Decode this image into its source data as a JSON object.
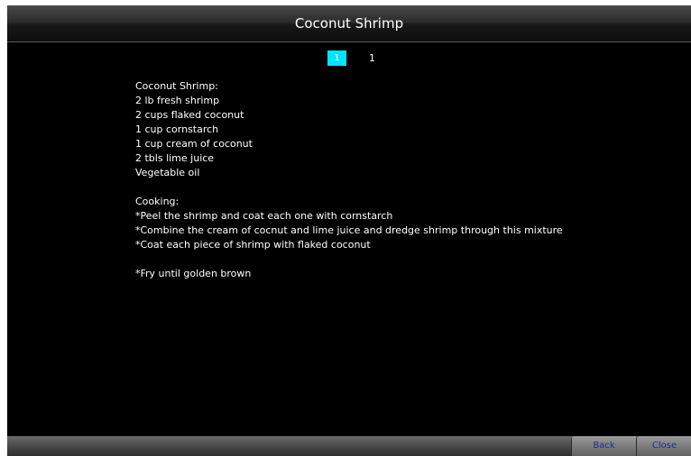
{
  "window": {
    "title": "Coconut Shrimp"
  },
  "pager": {
    "current_page": "1",
    "total_pages": "1"
  },
  "recipe": {
    "lines": [
      "Coconut Shrimp:",
      "2 lb fresh shrimp",
      "2 cups flaked coconut",
      "1 cup cornstarch",
      "1 cup cream of coconut",
      "2 tbls lime juice",
      "Vegetable oil",
      "",
      "Cooking:",
      "*Peel the shrimp and coat each one with cornstarch",
      "*Combine the cream of cocnut and lime juice and dredge shrimp through this mixture",
      "*Coat each piece of shrimp with flaked coconut",
      "",
      "*Fry until golden brown"
    ]
  },
  "buttons": {
    "back_label": "Back",
    "close_label": "Close"
  },
  "colors": {
    "background": "#000000",
    "text": "#ffffff",
    "page_highlight": "#00e5ff",
    "button_text": "#1a2f9a"
  }
}
